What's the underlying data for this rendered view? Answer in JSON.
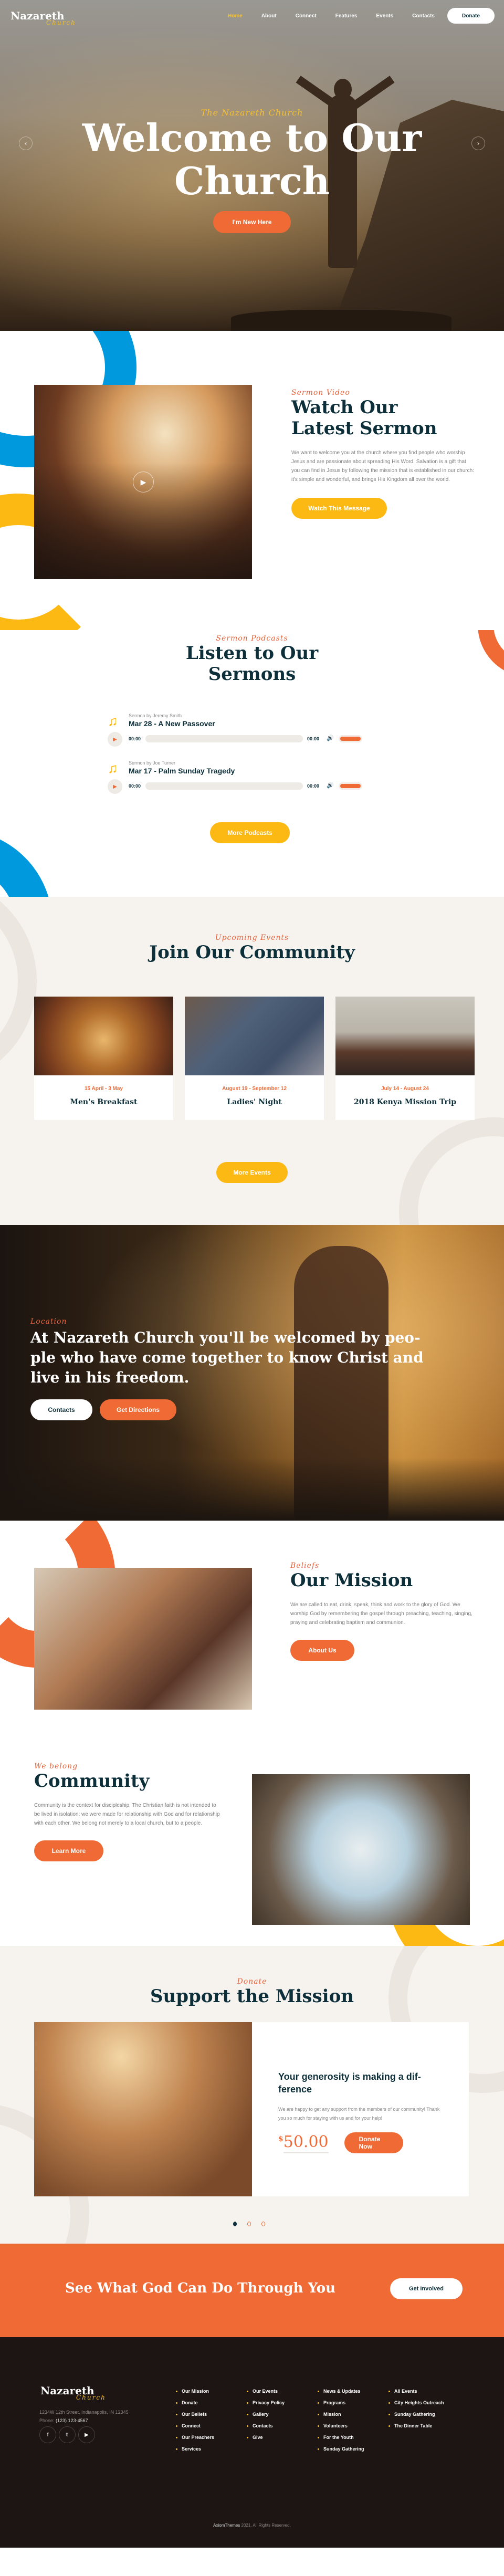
{
  "header": {
    "logo_main": "Nazareth",
    "logo_script": "Church",
    "nav": [
      {
        "label": "Home",
        "active": true
      },
      {
        "label": "About",
        "active": false
      },
      {
        "label": "Connect",
        "active": false
      },
      {
        "label": "Features",
        "active": false
      },
      {
        "label": "Events",
        "active": false
      },
      {
        "label": "Contacts",
        "active": false
      }
    ],
    "donate_label": "Donate"
  },
  "hero": {
    "eyebrow": "The Nazareth Church",
    "title_line1": "Welcome to Our",
    "title_line2": "Church",
    "cta_label": "I'm New Here",
    "prev_icon": "chevron-left-icon",
    "next_icon": "chevron-right-icon"
  },
  "sermon_video": {
    "eyebrow": "Sermon Video",
    "title_line1": "Watch Our",
    "title_line2": "Latest Sermon",
    "body": "We want to welcome you at the church where you find people who worship Jesus and are passionate about spreading His Word. Salvation is a gift that you can find in Jesus by following the mission that is established in our church: it's simple and wonderful, and brings His Kingdom all over the world.",
    "cta_label": "Watch This Message"
  },
  "podcasts": {
    "eyebrow": "Sermon Podcasts",
    "title_line1": "Listen to Our",
    "title_line2": "Sermons",
    "tracks": [
      {
        "by": "Sermon by Jeremy Smith",
        "title": "Mar 28 - A New Passover",
        "current": "00:00",
        "duration": "00:00",
        "progress_pct": 0,
        "volume_pct": 100
      },
      {
        "by": "Sermon by Joe Turner",
        "title": "Mar 17 - Palm Sunday Tragedy",
        "current": "00:00",
        "duration": "00:00",
        "progress_pct": 0,
        "volume_pct": 100
      }
    ],
    "cta_label": "More Podcasts"
  },
  "events": {
    "eyebrow": "Upcoming Events",
    "title": "Join Our Community",
    "items": [
      {
        "date": "15 April - 3 May",
        "title": "Men's Breakfast"
      },
      {
        "date": "August 19 - September 12",
        "title": "Ladies' Night"
      },
      {
        "date": "July 14 - August 24",
        "title": "2018 Kenya Mission Trip"
      }
    ],
    "cta_label": "More Events"
  },
  "location": {
    "eyebrow": "Location",
    "title": "At Nazareth Church you'll be welcomed by peo-ple who have come together to know Christ and live in his freedom.",
    "contacts_label": "Contacts",
    "directions_label": "Get Directions"
  },
  "mission": {
    "eyebrow": "Beliefs",
    "title": "Our Mission",
    "body": "We are called to eat, drink, speak, think and work to the glory of God. We worship God by remembering the gospel through preaching, teaching, singing, praying and celebrating baptism and communion.",
    "cta_label": "About Us"
  },
  "community": {
    "eyebrow": "We belong",
    "title": "Community",
    "body": "Community is the context for discipleship. The Christian faith is not intended to be lived in isolation; we were made for relationship with God and for relationship with each other. We belong not merely to a local church, but to a people.",
    "cta_label": "Learn More"
  },
  "donate": {
    "eyebrow": "Donate",
    "title": "Support the Mission",
    "card_title": "Your generosity is making a dif-ference",
    "card_body": "We are happy to get any support from the members of our community! Thank you so much for staying with us and for your help!",
    "currency": "$",
    "amount": "50.00",
    "cta_label": "Donate Now",
    "slides": 3,
    "active_slide": 1
  },
  "cta_banner": {
    "title": "See What God Can Do Through You",
    "button_label": "Get Involved"
  },
  "footer": {
    "logo_main": "Nazareth",
    "logo_script": "Church",
    "address": "1234W 12th Street, Indianapolis, IN 12345",
    "phone_label": "Phone:",
    "phone": "(123) 123-4567",
    "socials": [
      "facebook-icon",
      "twitter-icon",
      "youtube-icon"
    ],
    "columns": [
      [
        "Our Mission",
        "Donate",
        "Our Beliefs",
        "Connect",
        "Our Preachers",
        "Services"
      ],
      [
        "Our Events",
        "Privacy Policy",
        "Gallery",
        "Contacts",
        "Give"
      ],
      [
        "News & Updates",
        "Programs",
        "Mission",
        "Volunteers",
        "For the Youth",
        "Sunday Gathering"
      ],
      [
        "All Events",
        "City Heights Outreach",
        "Sunday Gathering",
        "The Dinner Table"
      ]
    ],
    "copyright_brand": "AxiomThemes",
    "copyright_text": "2021. All Rights Reserved."
  },
  "colors": {
    "navy": "#0d2f3a",
    "orange": "#f06a35",
    "yellow": "#fdb913",
    "blue": "#0099dd",
    "cream": "#f6f3ef",
    "footer_bg": "#1c1513"
  }
}
